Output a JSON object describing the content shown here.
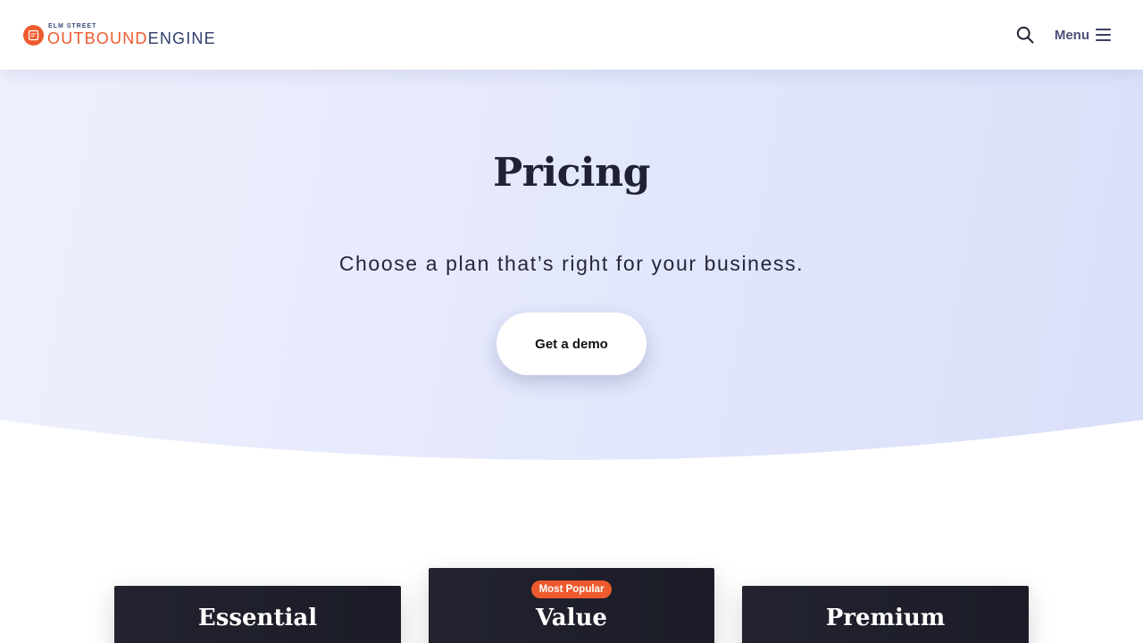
{
  "header": {
    "logo_sub": "ELM STREET",
    "logo_outbound": "OUTBOUND",
    "logo_engine": "ENGINE",
    "menu_label": "Menu",
    "search_icon": "search-icon",
    "menu_icon": "hamburger-menu-icon"
  },
  "hero": {
    "title": "Pricing",
    "subtitle": "Choose a plan that’s right for your business.",
    "cta_label": "Get a demo"
  },
  "plans": [
    {
      "name": "Essential"
    },
    {
      "name": "Value",
      "badge": "Most Popular"
    },
    {
      "name": "Premium"
    }
  ],
  "colors": {
    "brand_orange": "#ee5a2d",
    "brand_navy": "#2f3d6b",
    "card_dark": "#1f202b",
    "hero_bg": "#e4e8fb"
  }
}
